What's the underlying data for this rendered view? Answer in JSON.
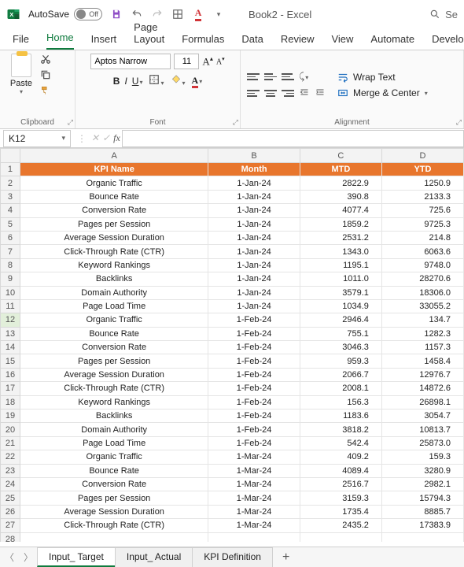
{
  "title": {
    "autosave": "AutoSave",
    "autosave_state": "Off",
    "doc": "Book2 - Excel",
    "search": "Se"
  },
  "tabs": [
    "File",
    "Home",
    "Insert",
    "Page Layout",
    "Formulas",
    "Data",
    "Review",
    "View",
    "Automate",
    "Developer"
  ],
  "active_tab": "Home",
  "ribbon": {
    "clipboard": {
      "paste": "Paste",
      "label": "Clipboard"
    },
    "font": {
      "name": "Aptos Narrow",
      "size": "11",
      "label": "Font"
    },
    "alignment": {
      "wrap": "Wrap Text",
      "merge": "Merge & Center",
      "label": "Alignment"
    }
  },
  "namebox": "K12",
  "formula": "",
  "columns": [
    "A",
    "B",
    "C",
    "D"
  ],
  "header_row": [
    "KPI Name",
    "Month",
    "MTD",
    "YTD"
  ],
  "rows": [
    {
      "a": "Organic Traffic",
      "b": "1-Jan-24",
      "c": "2822.9",
      "d": "1250.9"
    },
    {
      "a": "Bounce Rate",
      "b": "1-Jan-24",
      "c": "390.8",
      "d": "2133.3"
    },
    {
      "a": "Conversion Rate",
      "b": "1-Jan-24",
      "c": "4077.4",
      "d": "725.6"
    },
    {
      "a": "Pages per Session",
      "b": "1-Jan-24",
      "c": "1859.2",
      "d": "9725.3"
    },
    {
      "a": "Average Session Duration",
      "b": "1-Jan-24",
      "c": "2531.2",
      "d": "214.8"
    },
    {
      "a": "Click-Through Rate (CTR)",
      "b": "1-Jan-24",
      "c": "1343.0",
      "d": "6063.6"
    },
    {
      "a": "Keyword Rankings",
      "b": "1-Jan-24",
      "c": "1195.1",
      "d": "9748.0"
    },
    {
      "a": "Backlinks",
      "b": "1-Jan-24",
      "c": "1011.0",
      "d": "28270.6"
    },
    {
      "a": "Domain Authority",
      "b": "1-Jan-24",
      "c": "3579.1",
      "d": "18306.0"
    },
    {
      "a": "Page Load Time",
      "b": "1-Jan-24",
      "c": "1034.9",
      "d": "33055.2"
    },
    {
      "a": "Organic Traffic",
      "b": "1-Feb-24",
      "c": "2946.4",
      "d": "134.7"
    },
    {
      "a": "Bounce Rate",
      "b": "1-Feb-24",
      "c": "755.1",
      "d": "1282.3"
    },
    {
      "a": "Conversion Rate",
      "b": "1-Feb-24",
      "c": "3046.3",
      "d": "1157.3"
    },
    {
      "a": "Pages per Session",
      "b": "1-Feb-24",
      "c": "959.3",
      "d": "1458.4"
    },
    {
      "a": "Average Session Duration",
      "b": "1-Feb-24",
      "c": "2066.7",
      "d": "12976.7"
    },
    {
      "a": "Click-Through Rate (CTR)",
      "b": "1-Feb-24",
      "c": "2008.1",
      "d": "14872.6"
    },
    {
      "a": "Keyword Rankings",
      "b": "1-Feb-24",
      "c": "156.3",
      "d": "26898.1"
    },
    {
      "a": "Backlinks",
      "b": "1-Feb-24",
      "c": "1183.6",
      "d": "3054.7"
    },
    {
      "a": "Domain Authority",
      "b": "1-Feb-24",
      "c": "3818.2",
      "d": "10813.7"
    },
    {
      "a": "Page Load Time",
      "b": "1-Feb-24",
      "c": "542.4",
      "d": "25873.0"
    },
    {
      "a": "Organic Traffic",
      "b": "1-Mar-24",
      "c": "409.2",
      "d": "159.3"
    },
    {
      "a": "Bounce Rate",
      "b": "1-Mar-24",
      "c": "4089.4",
      "d": "3280.9"
    },
    {
      "a": "Conversion Rate",
      "b": "1-Mar-24",
      "c": "2516.7",
      "d": "2982.1"
    },
    {
      "a": "Pages per Session",
      "b": "1-Mar-24",
      "c": "3159.3",
      "d": "15794.3"
    },
    {
      "a": "Average Session Duration",
      "b": "1-Mar-24",
      "c": "1735.4",
      "d": "8885.7"
    },
    {
      "a": "Click-Through Rate (CTR)",
      "b": "1-Mar-24",
      "c": "2435.2",
      "d": "17383.9"
    }
  ],
  "sheets": [
    "Input_ Target",
    "Input_ Actual",
    "KPI Definition"
  ],
  "active_sheet": 0
}
